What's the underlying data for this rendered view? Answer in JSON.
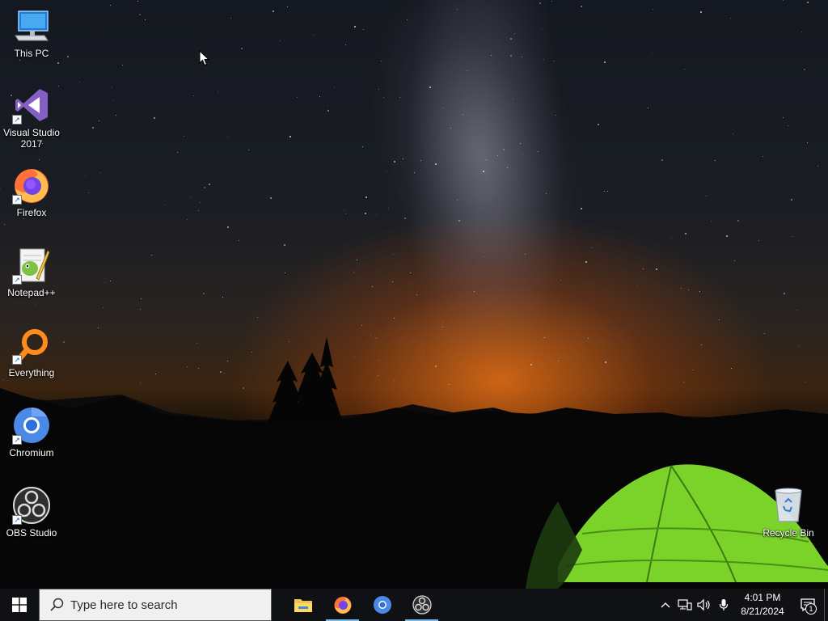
{
  "desktop": {
    "icons": [
      {
        "label": "This PC",
        "icon": "this-pc-icon"
      },
      {
        "label": "Visual Studio 2017",
        "icon": "visual-studio-icon"
      },
      {
        "label": "Firefox",
        "icon": "firefox-icon"
      },
      {
        "label": "Notepad++",
        "icon": "notepad-plus-plus-icon"
      },
      {
        "label": "Everything",
        "icon": "everything-search-icon"
      },
      {
        "label": "Chromium",
        "icon": "chromium-icon"
      },
      {
        "label": "OBS Studio",
        "icon": "obs-studio-icon"
      },
      {
        "label": "Recycle Bin",
        "icon": "recycle-bin-icon"
      }
    ]
  },
  "taskbar": {
    "search_placeholder": "Type here to search",
    "apps": [
      "file-explorer-icon",
      "firefox-icon",
      "chromium-icon",
      "obs-studio-icon"
    ],
    "clock": {
      "time": "4:01 PM",
      "date": "8/21/2024"
    },
    "notification_count": "1",
    "accent_color": "#76b9ed"
  }
}
